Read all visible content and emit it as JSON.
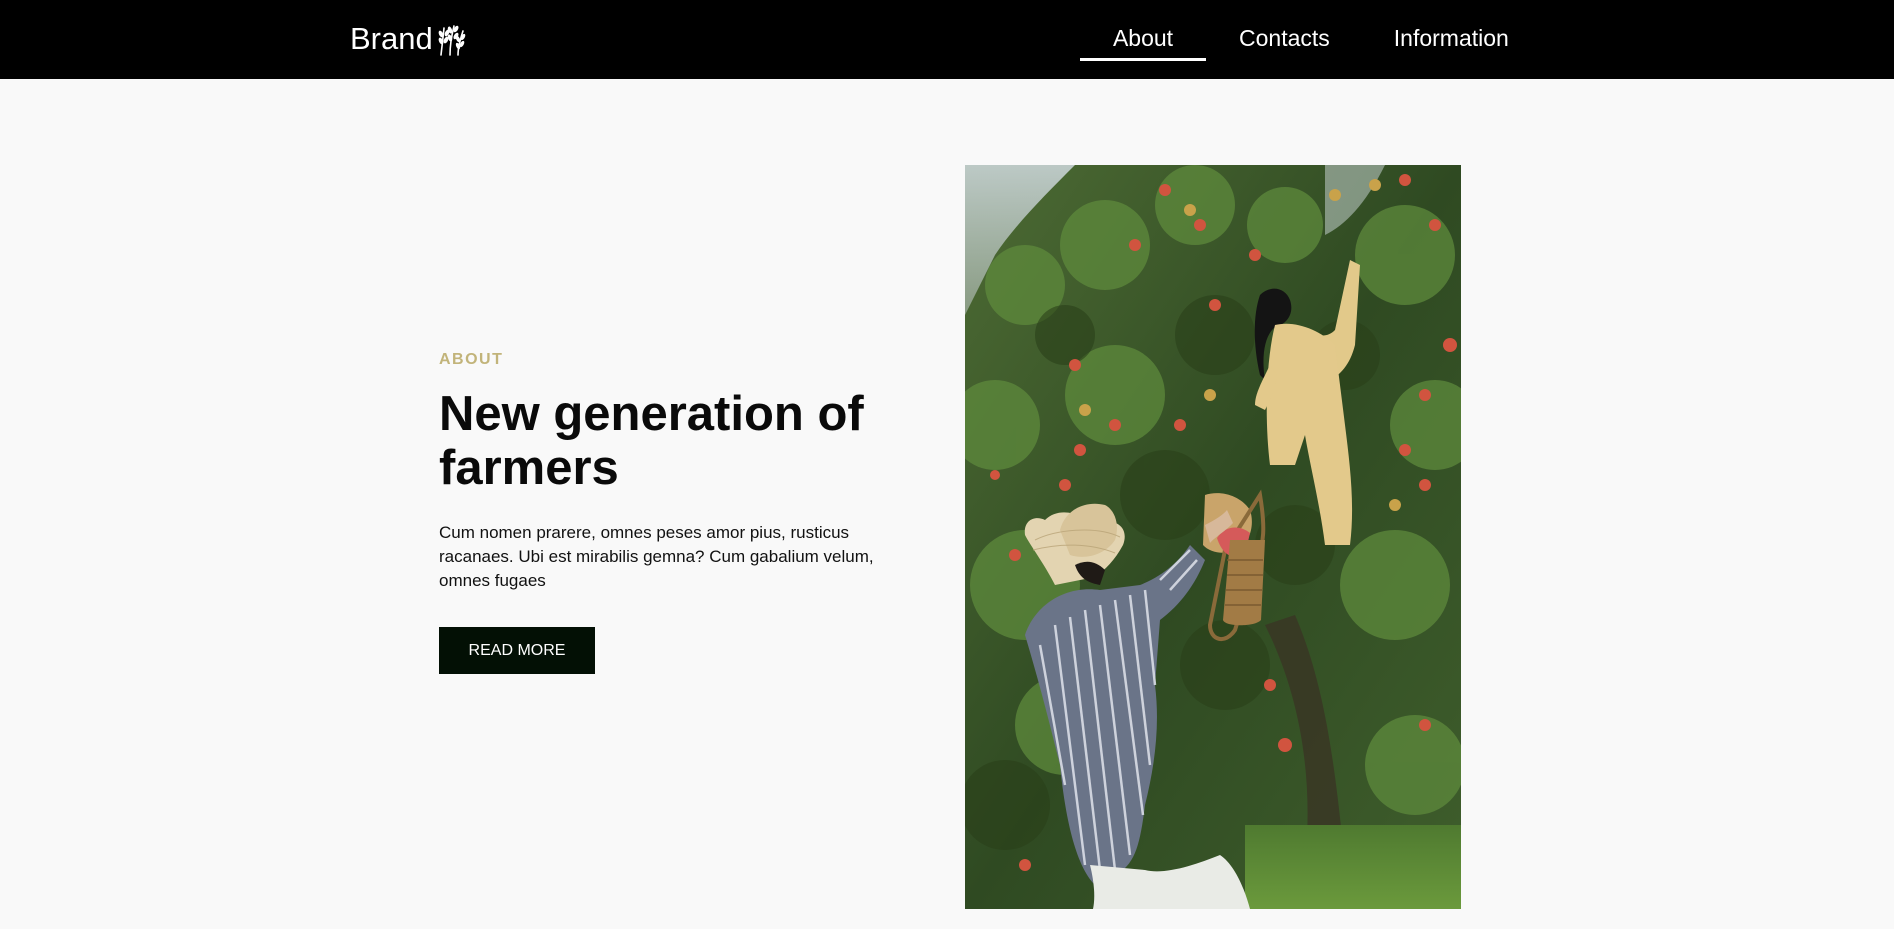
{
  "header": {
    "brand": "Brand",
    "brand_icon": "wheat-icon",
    "nav": [
      {
        "label": "About",
        "active": true
      },
      {
        "label": "Contacts",
        "active": false
      },
      {
        "label": "Information",
        "active": false
      }
    ]
  },
  "hero": {
    "eyebrow": "ABOUT",
    "headline": "New generation of farmers",
    "body": "Cum nomen prarere, omnes peses amor pius, rusticus racanaes. Ubi est mirabilis gemna? Cum gabalium velum, omnes fugaes",
    "button_label": "READ MORE",
    "image_subject": "farmers-picking-apples-photo"
  },
  "colors": {
    "header_bg": "#000000",
    "page_bg": "#f9f9f9",
    "accent": "#c2b47a",
    "button_bg": "#031005"
  }
}
